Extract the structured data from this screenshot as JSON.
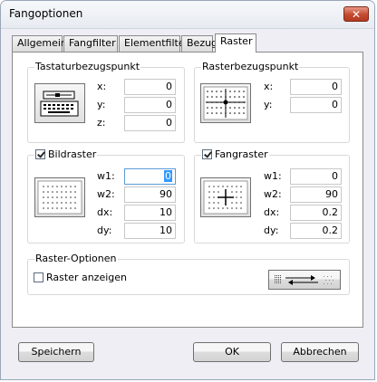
{
  "window": {
    "title": "Fangoptionen",
    "close_glyph": "✕"
  },
  "tabs": [
    {
      "label": "Allgemein"
    },
    {
      "label": "Fangfilter"
    },
    {
      "label": "Elementfilter"
    },
    {
      "label": "Bezug"
    },
    {
      "label": "Raster",
      "active": true
    }
  ],
  "tastatur": {
    "title": "Tastaturbezugspunkt",
    "icon": "keyboard-icon",
    "x_label": "x:",
    "x_value": "0",
    "y_label": "y:",
    "y_value": "0",
    "z_label": "z:",
    "z_value": "0"
  },
  "raster_bezug": {
    "title": "Rasterbezugspunkt",
    "icon": "grid-reference-point-icon",
    "x_label": "x:",
    "x_value": "0",
    "y_label": "y:",
    "y_value": "0"
  },
  "bildraster": {
    "title": "Bildraster",
    "checked": true,
    "icon": "dot-grid-icon",
    "w1_label": "w1:",
    "w1_value": "0",
    "w2_label": "w2:",
    "w2_value": "90",
    "dx_label": "dx:",
    "dx_value": "10",
    "dy_label": "dy:",
    "dy_value": "10"
  },
  "fangraster": {
    "title": "Fangraster",
    "checked": true,
    "icon": "snap-grid-crosshair-icon",
    "w1_label": "w1:",
    "w1_value": "0",
    "w2_label": "w2:",
    "w2_value": "90",
    "dx_label": "dx:",
    "dx_value": "0.2",
    "dy_label": "dy:",
    "dy_value": "0.2"
  },
  "raster_optionen": {
    "title": "Raster-Optionen",
    "show_label": "Raster anzeigen",
    "show_checked": false,
    "swap_icon": "grid-swap-icon"
  },
  "footer": {
    "save": "Speichern",
    "ok": "OK",
    "cancel": "Abbrechen"
  }
}
